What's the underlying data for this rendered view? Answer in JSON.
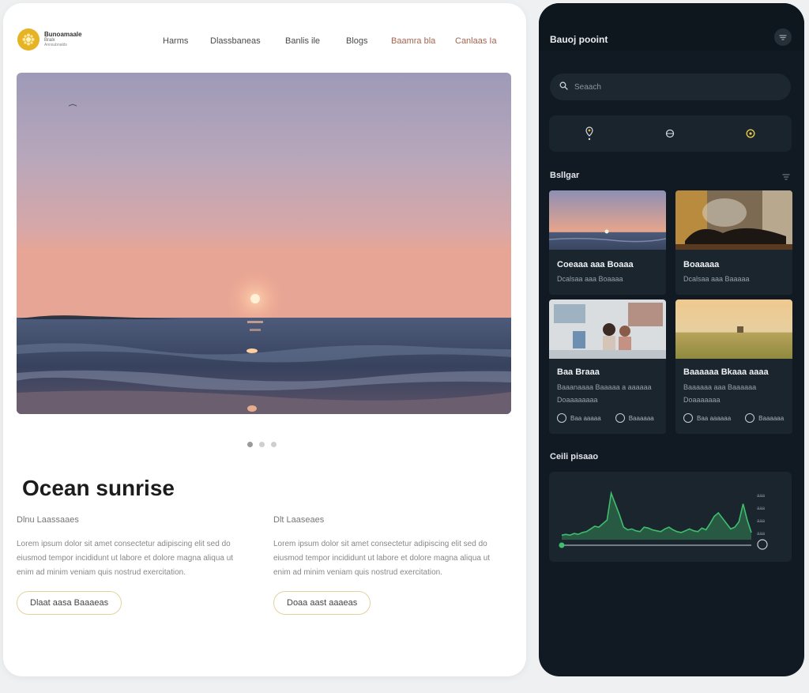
{
  "brand": {
    "name": "Bunoamaale",
    "tag": "Bralx",
    "sub": "Annsubnalds"
  },
  "nav": [
    {
      "label": "Harms",
      "accent": false
    },
    {
      "label": "Dlassbaneas",
      "accent": false
    },
    {
      "label": "Banlis ile",
      "accent": false
    },
    {
      "label": "Blogs",
      "accent": false
    },
    {
      "label": "Baamra bla",
      "accent": true
    },
    {
      "label": "Canlaas Ia",
      "accent": true
    }
  ],
  "hero": {
    "alt": "Ocean sunrise"
  },
  "carousel": {
    "count": 3,
    "active": 0
  },
  "main": {
    "title": "Ocean sunrise",
    "col1": {
      "heading": "Dlnu Laassaaes",
      "body": "Lorem ipsum dolor sit amet consectetur adipiscing elit sed do eiusmod tempor incididunt ut labore et dolore magna aliqua ut enim ad minim veniam quis nostrud exercitation.",
      "button": "Dlaat aasa Baaaeas"
    },
    "col2": {
      "heading": "Dlt Laaseaes",
      "body": "Lorem ipsum dolor sit amet consectetur adipiscing elit sed do eiusmod tempor incididunt ut labore et dolore magna aliqua ut enim ad minim veniam quis nostrud exercitation.",
      "button": "Doaa aast aaaeas"
    }
  },
  "panel": {
    "title": "Bauoj pooint",
    "search_placeholder": "Seaach",
    "section1": "Bsllgar",
    "tiles": [
      {
        "title": "Coeaaa aaa Boaaa",
        "meta": [
          "Dcalsaa aaa Boaaaa"
        ],
        "actions": []
      },
      {
        "title": "Boaaaaa",
        "meta": [
          "Dcalsaa aaa Baaaaa"
        ],
        "actions": []
      },
      {
        "title": "Baa Braaa",
        "meta": [
          "Baaanaaaa Baaaaa a aaaaaa",
          "Doaaaaaaaa"
        ],
        "actions": [
          "Baa aaaaa",
          "Baaaaaa"
        ]
      },
      {
        "title": "Baaaaaa Bkaaa aaaa",
        "meta": [
          "Baaaaaa aaa Baaaaaa",
          "Doaaaaaaa"
        ],
        "actions": [
          "Baa aaaaaa",
          "Baaaaaa"
        ]
      }
    ],
    "section2": "Ceili pisaao",
    "chart_y_labels": [
      "aaa",
      "aaa",
      "aaa",
      "aaa"
    ]
  },
  "colors": {
    "accent_gold": "#e6b325",
    "chart_line": "#3fbf6d",
    "panel_bg": "#111a22"
  },
  "chart_data": {
    "type": "area",
    "title": "",
    "xlabel": "",
    "ylabel": "",
    "y": [
      5,
      6,
      5,
      7,
      6,
      8,
      9,
      12,
      15,
      14,
      18,
      22,
      52,
      40,
      28,
      14,
      11,
      12,
      10,
      9,
      14,
      13,
      11,
      10,
      9,
      12,
      14,
      11,
      9,
      8,
      10,
      12,
      10,
      9,
      13,
      11,
      18,
      26,
      30,
      24,
      18,
      12,
      14,
      20,
      40,
      22,
      8
    ],
    "ylim": [
      0,
      60
    ]
  }
}
